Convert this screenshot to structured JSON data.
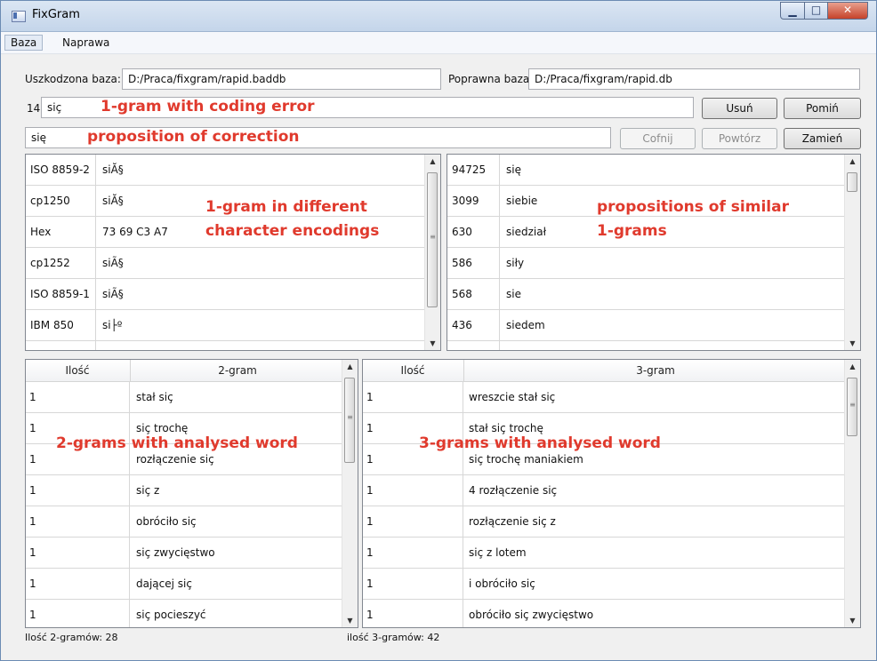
{
  "window": {
    "title": "FixGram"
  },
  "menu": {
    "items": [
      "Baza",
      "Naprawa"
    ]
  },
  "top_fields": {
    "damaged_label": "Uszkodzona baza:",
    "damaged_value": "D:/Praca/fixgram/rapid.baddb",
    "correct_label": "Poprawna baza",
    "correct_value": "D:/Praca/fixgram/rapid.db"
  },
  "word_row": {
    "count": "14",
    "word": "siç",
    "delete_label": "Usuń",
    "skip_label": "Pomiń"
  },
  "correction_row": {
    "value": "się",
    "undo_label": "Cofnij",
    "redo_label": "Powtórz",
    "replace_label": "Zamień"
  },
  "annotations": {
    "coding_error": "1-gram with coding error",
    "proposition": "proposition of correction",
    "encodings_1": "1-gram in different",
    "encodings_2": "character encodings",
    "similar_1": "propositions of similar",
    "similar_2": "1-grams",
    "bigrams": "2-grams with analysed word",
    "trigrams": "3-grams with analysed word"
  },
  "encodings": {
    "rows": [
      {
        "name": "ISO 8859-2",
        "value": "siĂ§"
      },
      {
        "name": "cp1250",
        "value": "siĂ§"
      },
      {
        "name": "Hex",
        "value": "73 69 C3 A7"
      },
      {
        "name": "cp1252",
        "value": "siÃ§"
      },
      {
        "name": "ISO 8859-1",
        "value": "siÃ§"
      },
      {
        "name": "IBM 850",
        "value": "si├º"
      }
    ]
  },
  "similar": {
    "rows": [
      {
        "count": "94725",
        "word": "się"
      },
      {
        "count": "3099",
        "word": "siebie"
      },
      {
        "count": "630",
        "word": "siedział"
      },
      {
        "count": "586",
        "word": "siły"
      },
      {
        "count": "568",
        "word": "sie"
      },
      {
        "count": "436",
        "word": "siedem"
      }
    ]
  },
  "bigrams": {
    "headers": [
      "Ilość",
      "2-gram"
    ],
    "rows": [
      {
        "count": "1",
        "gram": "stał siç"
      },
      {
        "count": "1",
        "gram": "siç trochę"
      },
      {
        "count": "1",
        "gram": "rozłączenie siç"
      },
      {
        "count": "1",
        "gram": "siç z"
      },
      {
        "count": "1",
        "gram": "obróciło siç"
      },
      {
        "count": "1",
        "gram": "siç zwycięstwo"
      },
      {
        "count": "1",
        "gram": "dającej siç"
      },
      {
        "count": "1",
        "gram": "siç pocieszyć"
      }
    ]
  },
  "trigrams": {
    "headers": [
      "Ilość",
      "3-gram"
    ],
    "rows": [
      {
        "count": "1",
        "gram": "wreszcie stał siç"
      },
      {
        "count": "1",
        "gram": "stał siç trochę"
      },
      {
        "count": "1",
        "gram": "siç trochę maniakiem"
      },
      {
        "count": "1",
        "gram": "4 rozłączenie siç"
      },
      {
        "count": "1",
        "gram": "rozłączenie siç z"
      },
      {
        "count": "1",
        "gram": "siç z lotem"
      },
      {
        "count": "1",
        "gram": "i obróciło siç"
      },
      {
        "count": "1",
        "gram": "obróciło siç zwycięstwo"
      }
    ]
  },
  "status": {
    "bigram_count": "Ilość 2-gramów:  28",
    "trigram_count": "ilość 3-gramów:  42"
  }
}
